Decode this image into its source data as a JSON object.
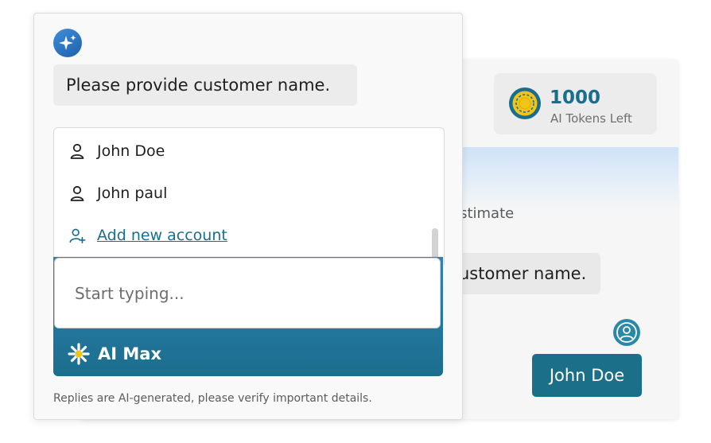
{
  "background_panel": {
    "tokens": {
      "count": "1000",
      "label": "AI Tokens Left"
    },
    "estimate_text": "estimate",
    "bubble_text": "ustomer name.",
    "reply_button": "John Doe"
  },
  "chat": {
    "prompt": "Please provide customer name.",
    "dropdown": {
      "items": [
        {
          "label": "John Doe",
          "icon": "person-icon"
        },
        {
          "label": "John paul",
          "icon": "person-icon"
        }
      ],
      "add_account": {
        "label": "Add new account",
        "icon": "person-add-icon"
      }
    },
    "input": {
      "placeholder": "Start typing...",
      "value": ""
    },
    "brand": {
      "name": "AI Max",
      "icon": "sparkle-asterisk-icon"
    },
    "disclaimer": "Replies are AI-generated, please verify important details."
  },
  "colors": {
    "accent": "#1b6f88",
    "link": "#1a6e8d",
    "gradient_top": "#2f82b4",
    "coin": "#f2c318"
  }
}
